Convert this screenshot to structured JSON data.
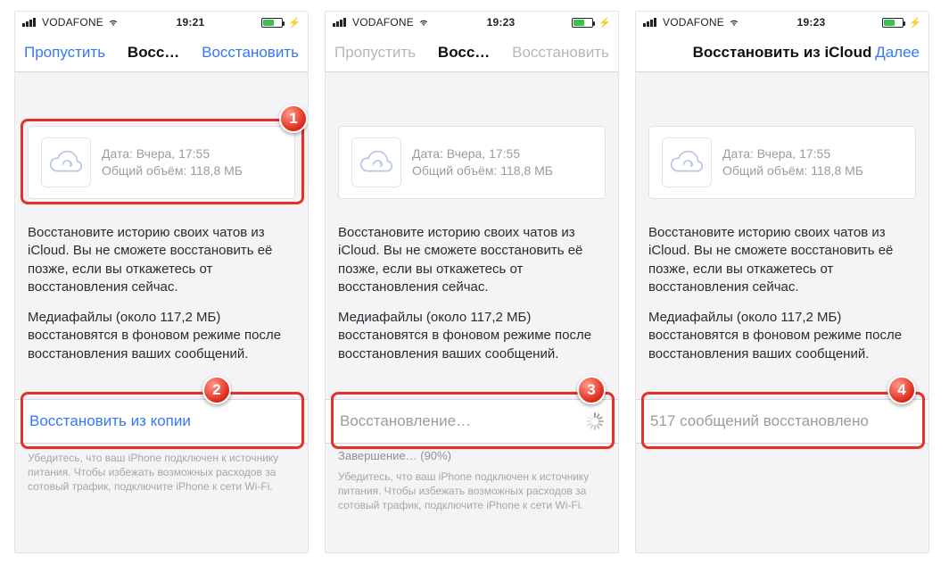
{
  "screens": [
    {
      "status": {
        "carrier": "VODAFONE",
        "time": "19:21"
      },
      "nav": {
        "left": "Пропустить",
        "title": "Восс…",
        "right": "Восстановить",
        "dim": false
      },
      "backup": {
        "date_line": "Дата: Вчера, 17:55",
        "size_line": "Общий объём: 118,8 МБ"
      },
      "desc1": "Восстановите историю своих чатов из iCloud. Вы не сможете восстановить её позже, если вы откажетесь от восстановления сейчас.",
      "desc2": "Медиафайлы (около 117,2 МБ) восстановятся в фоновом режиме после восстановления ваших сообщений.",
      "action": {
        "label": "Восстановить из копии",
        "style": "blue",
        "spinner": false
      },
      "hint": "Убедитесь, что ваш iPhone подключен к источнику питания. Чтобы избежать возможных расходов за сотовый трафик, подключите iPhone к сети Wi-Fi.",
      "progress": "",
      "hl_card": true,
      "hl_action": true,
      "badge_card": "1",
      "badge_action": "2"
    },
    {
      "status": {
        "carrier": "VODAFONE",
        "time": "19:23"
      },
      "nav": {
        "left": "Пропустить",
        "title": "Восс…",
        "right": "Восстановить",
        "dim": true
      },
      "backup": {
        "date_line": "Дата: Вчера, 17:55",
        "size_line": "Общий объём: 118,8 МБ"
      },
      "desc1": "Восстановите историю своих чатов из iCloud. Вы не сможете восстановить её позже, если вы откажетесь от восстановления сейчас.",
      "desc2": "Медиафайлы (около 117,2 МБ) восстановятся в фоновом режиме после восстановления ваших сообщений.",
      "action": {
        "label": "Восстановление…",
        "style": "gray",
        "spinner": true
      },
      "hint": "Убедитесь, что ваш iPhone подключен к источнику питания. Чтобы избежать возможных расходов за сотовый трафик, подключите iPhone к сети Wi-Fi.",
      "progress": "Завершение… (90%)",
      "hl_card": false,
      "hl_action": true,
      "badge_card": "",
      "badge_action": "3"
    },
    {
      "status": {
        "carrier": "VODAFONE",
        "time": "19:23"
      },
      "nav": {
        "left": "",
        "title": "Восстановить из iCloud",
        "right": "Далее",
        "dim": false,
        "wide": true
      },
      "backup": {
        "date_line": "Дата: Вчера, 17:55",
        "size_line": "Общий объём: 118,8 МБ"
      },
      "desc1": "Восстановите историю своих чатов из iCloud. Вы не сможете восстановить её позже, если вы откажетесь от восстановления сейчас.",
      "desc2": "Медиафайлы (около 117,2 МБ) восстановятся в фоновом режиме после восстановления ваших сообщений.",
      "action": {
        "label": "517 сообщений восстановлено",
        "style": "gray",
        "spinner": false
      },
      "hint": "",
      "progress": "",
      "hl_card": false,
      "hl_action": true,
      "badge_card": "",
      "badge_action": "4"
    }
  ]
}
